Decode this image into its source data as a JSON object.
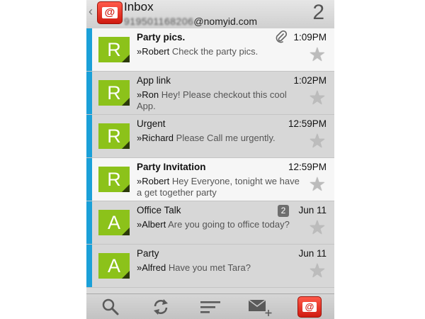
{
  "header": {
    "title": "Inbox",
    "account_masked": "919501168206",
    "account_domain": "@nomyid.com",
    "unread_count": "2",
    "logo_glyph": "@"
  },
  "messages": [
    {
      "subject": "Party pics.",
      "time": "1:09PM",
      "sender": "»Robert",
      "preview": "Check the party pics.",
      "avatar": "R",
      "unread": true,
      "attachment": true,
      "badge": ""
    },
    {
      "subject": "App link",
      "time": "1:02PM",
      "sender": "»Ron",
      "preview": "Hey! Please checkout this cool App.",
      "avatar": "R",
      "unread": false,
      "attachment": false,
      "badge": ""
    },
    {
      "subject": "Urgent",
      "time": "12:59PM",
      "sender": "»Richard",
      "preview": "Please Call me urgently.",
      "avatar": "R",
      "unread": false,
      "attachment": false,
      "badge": ""
    },
    {
      "subject": "Party Invitation",
      "time": "12:59PM",
      "sender": "»Robert",
      "preview": "Hey Everyone, tonight we have a get together party",
      "avatar": "R",
      "unread": true,
      "attachment": false,
      "badge": ""
    },
    {
      "subject": "Office Talk",
      "time": "Jun 11",
      "sender": "»Albert",
      "preview": "Are you going to office today?",
      "avatar": "A",
      "unread": false,
      "attachment": false,
      "badge": "2"
    },
    {
      "subject": "Party",
      "time": "Jun 11",
      "sender": "»Alfred",
      "preview": "Have you met Tara?",
      "avatar": "A",
      "unread": false,
      "attachment": false,
      "badge": ""
    }
  ],
  "toolbar": {
    "logo_glyph": "@"
  },
  "colors": {
    "accent_bar": "#1aa0d8",
    "avatar_green": "#8cc21a",
    "logo_red": "#d01a10"
  }
}
